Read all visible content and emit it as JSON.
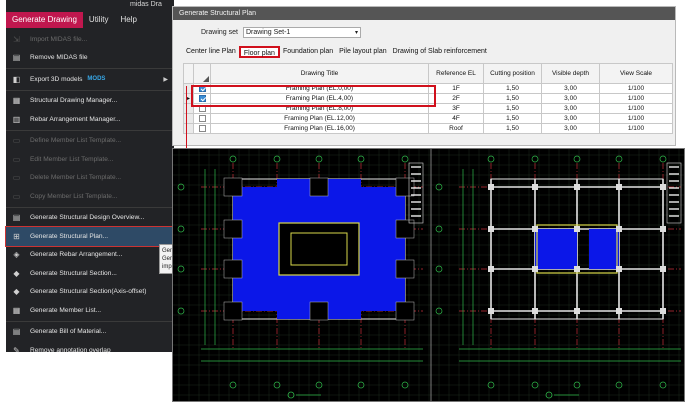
{
  "menu": {
    "title": "midas Dra",
    "tabs": [
      {
        "label": "Generate Drawing",
        "active": true
      },
      {
        "label": "Utility",
        "active": false
      },
      {
        "label": "Help",
        "active": false
      }
    ],
    "items": [
      {
        "label": "Import MIDAS file...",
        "icon": "import-icon",
        "disabled": true
      },
      {
        "label": "Remove MIDAS file",
        "icon": "remove-file-icon",
        "disabled": false
      },
      {
        "label": "Export 3D models",
        "icon": "export-3d-icon",
        "disabled": false,
        "badge": "MODS",
        "submenu": true
      },
      {
        "label": "Structural Drawing Manager...",
        "icon": "drawing-manager-icon",
        "disabled": false
      },
      {
        "label": "Rebar Arrangement Manager...",
        "icon": "rebar-manager-icon",
        "disabled": false
      },
      {
        "label": "Define Member List Template...",
        "icon": "define-template-icon",
        "disabled": true
      },
      {
        "label": "Edit Member List Template...",
        "icon": "edit-template-icon",
        "disabled": true
      },
      {
        "label": "Delete Member List Template...",
        "icon": "delete-template-icon",
        "disabled": true
      },
      {
        "label": "Copy Member List Template...",
        "icon": "copy-template-icon",
        "disabled": true
      },
      {
        "label": "Generate Structural Design Overview...",
        "icon": "design-overview-icon",
        "disabled": false
      },
      {
        "label": "Generate Structural Plan...",
        "icon": "structural-plan-icon",
        "disabled": false,
        "highlighted": true
      },
      {
        "label": "Generate Rebar Arrangement...",
        "icon": "rebar-arrangement-icon",
        "disabled": false
      },
      {
        "label": "Generate Structural Section...",
        "icon": "section-icon",
        "disabled": false
      },
      {
        "label": "Generate Structural Section(Axis-offset)",
        "icon": "section-offset-icon",
        "disabled": false
      },
      {
        "label": "Generate Member List...",
        "icon": "member-list-icon",
        "disabled": false
      },
      {
        "label": "Generate Bill of Material...",
        "icon": "bill-icon",
        "disabled": false
      },
      {
        "label": "Remove annotation overlap",
        "icon": "annotation-icon",
        "disabled": false
      }
    ],
    "tooltip": "Gene Gene impr"
  },
  "dialog": {
    "title": "Generate Structural Plan",
    "drawing_set_label": "Drawing set",
    "drawing_set_value": "Drawing Set-1",
    "tabs": [
      {
        "label": "Center line Plan",
        "active": false
      },
      {
        "label": "Floor plan",
        "active": true
      },
      {
        "label": "Foundation plan",
        "active": false
      },
      {
        "label": "Pile layout plan",
        "active": false
      },
      {
        "label": "Drawing of Slab reinforcement",
        "active": false
      }
    ],
    "columns": [
      "Drawing Title",
      "Reference EL",
      "Cutting position",
      "Visible depth",
      "View Scale"
    ],
    "rows": [
      {
        "checked": true,
        "current": false,
        "title": "Framing Plan (EL.0,00)",
        "ref": "1F",
        "cut": "1,50",
        "depth": "3,00",
        "scale": "1/100"
      },
      {
        "checked": true,
        "current": true,
        "title": "Framing Plan (EL.4,00)",
        "ref": "2F",
        "cut": "1,50",
        "depth": "3,00",
        "scale": "1/100"
      },
      {
        "checked": false,
        "current": false,
        "title": "Framing Plan (EL.8,00)",
        "ref": "3F",
        "cut": "1,50",
        "depth": "3,00",
        "scale": "1/100"
      },
      {
        "checked": false,
        "current": false,
        "title": "Framing Plan (EL.12,00)",
        "ref": "4F",
        "cut": "1,50",
        "depth": "3,00",
        "scale": "1/100"
      },
      {
        "checked": false,
        "current": false,
        "title": "Framing Plan (EL.16,00)",
        "ref": "Roof",
        "cut": "1,50",
        "depth": "3,00",
        "scale": "1/100"
      }
    ]
  },
  "colors": {
    "accent": "#c0174e",
    "highlight": "#d0101c",
    "slab_blue": "#0b17e8",
    "beam_yellow": "#d8d84a",
    "grid_green": "#2fb84a",
    "grid_red": "#c8303a",
    "cad_background": "#000000"
  }
}
